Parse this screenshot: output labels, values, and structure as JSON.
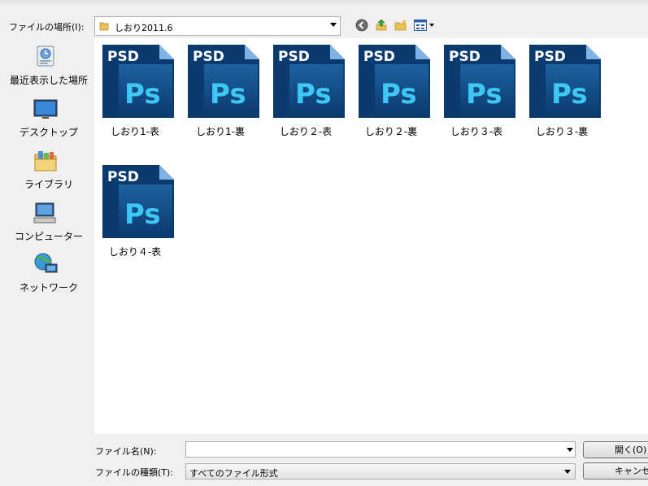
{
  "look_in": {
    "label": "ファイルの場所(I):",
    "value": "しおり2011.6"
  },
  "places": [
    {
      "label": "最近表示した場所",
      "icon": "recent-places-icon"
    },
    {
      "label": "デスクトップ",
      "icon": "desktop-icon"
    },
    {
      "label": "ライブラリ",
      "icon": "libraries-icon"
    },
    {
      "label": "コンピューター",
      "icon": "computer-icon"
    },
    {
      "label": "ネットワーク",
      "icon": "network-icon"
    }
  ],
  "files": [
    {
      "name": "しおり1-表",
      "badge": "PSD",
      "logo": "Ps"
    },
    {
      "name": "しおり1-裏",
      "badge": "PSD",
      "logo": "Ps"
    },
    {
      "name": "しおり２-表",
      "badge": "PSD",
      "logo": "Ps"
    },
    {
      "name": "しおり２-裏",
      "badge": "PSD",
      "logo": "Ps"
    },
    {
      "name": "しおり３-表",
      "badge": "PSD",
      "logo": "Ps"
    },
    {
      "name": "しおり３-裏",
      "badge": "PSD",
      "logo": "Ps"
    },
    {
      "name": "しおり４-表",
      "badge": "PSD",
      "logo": "Ps"
    }
  ],
  "filename": {
    "label": "ファイル名(N):",
    "value": ""
  },
  "filetype": {
    "label": "ファイルの種類(T):",
    "value": "すべてのファイル形式"
  },
  "buttons": {
    "open": "開く(O)",
    "cancel": "キャンセル"
  },
  "colors": {
    "psd_dark": "#0b3a6e",
    "psd_light": "#2f8ad2",
    "ps_text": "#3ec6f4"
  }
}
